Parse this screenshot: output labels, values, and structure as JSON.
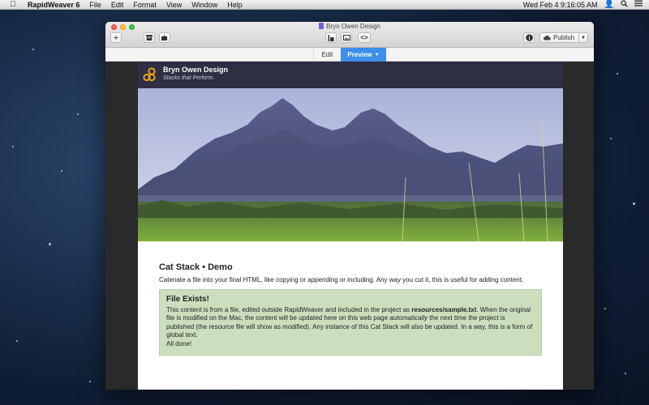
{
  "menubar": {
    "app_name": "RapidWeaver 6",
    "menus": [
      "File",
      "Edit",
      "Format",
      "View",
      "Window",
      "Help"
    ],
    "datetime": "Wed Feb 4  9:16:05 AM"
  },
  "window": {
    "title": "Bryn Owen Design",
    "add_label": "+",
    "publish_label": "Publish",
    "tabs": {
      "edit": "Edit",
      "preview": "Preview"
    }
  },
  "site": {
    "title": "Bryn Owen Design",
    "slogan": "Stacks that Perform.",
    "heading": "Cat Stack • Demo",
    "intro": "Catenate a file into your final HTML, like copying or appending or including. Any way you cut it, this is useful for adding content.",
    "box": {
      "title": "File Exists!",
      "body_1": "This content is from a file, edited outside RapidWeaver and included in the project as ",
      "filename": "resources/sample.txt",
      "body_2": ". When the original file is modified on the Mac, the content will be updated here on this web page ",
      "emphasis": "automatically",
      "body_3": " the next time the project is published (the resource file will show as modified). Any instance of this Cat Stack will also be updated. In a way, this is a form of global text.",
      "done": "All done!"
    }
  },
  "colors": {
    "header_bg": "#2e2f44",
    "logo_orange": "#f0a020",
    "preview_tab": "#3b8eea",
    "box_bg": "#cbdfbf"
  }
}
